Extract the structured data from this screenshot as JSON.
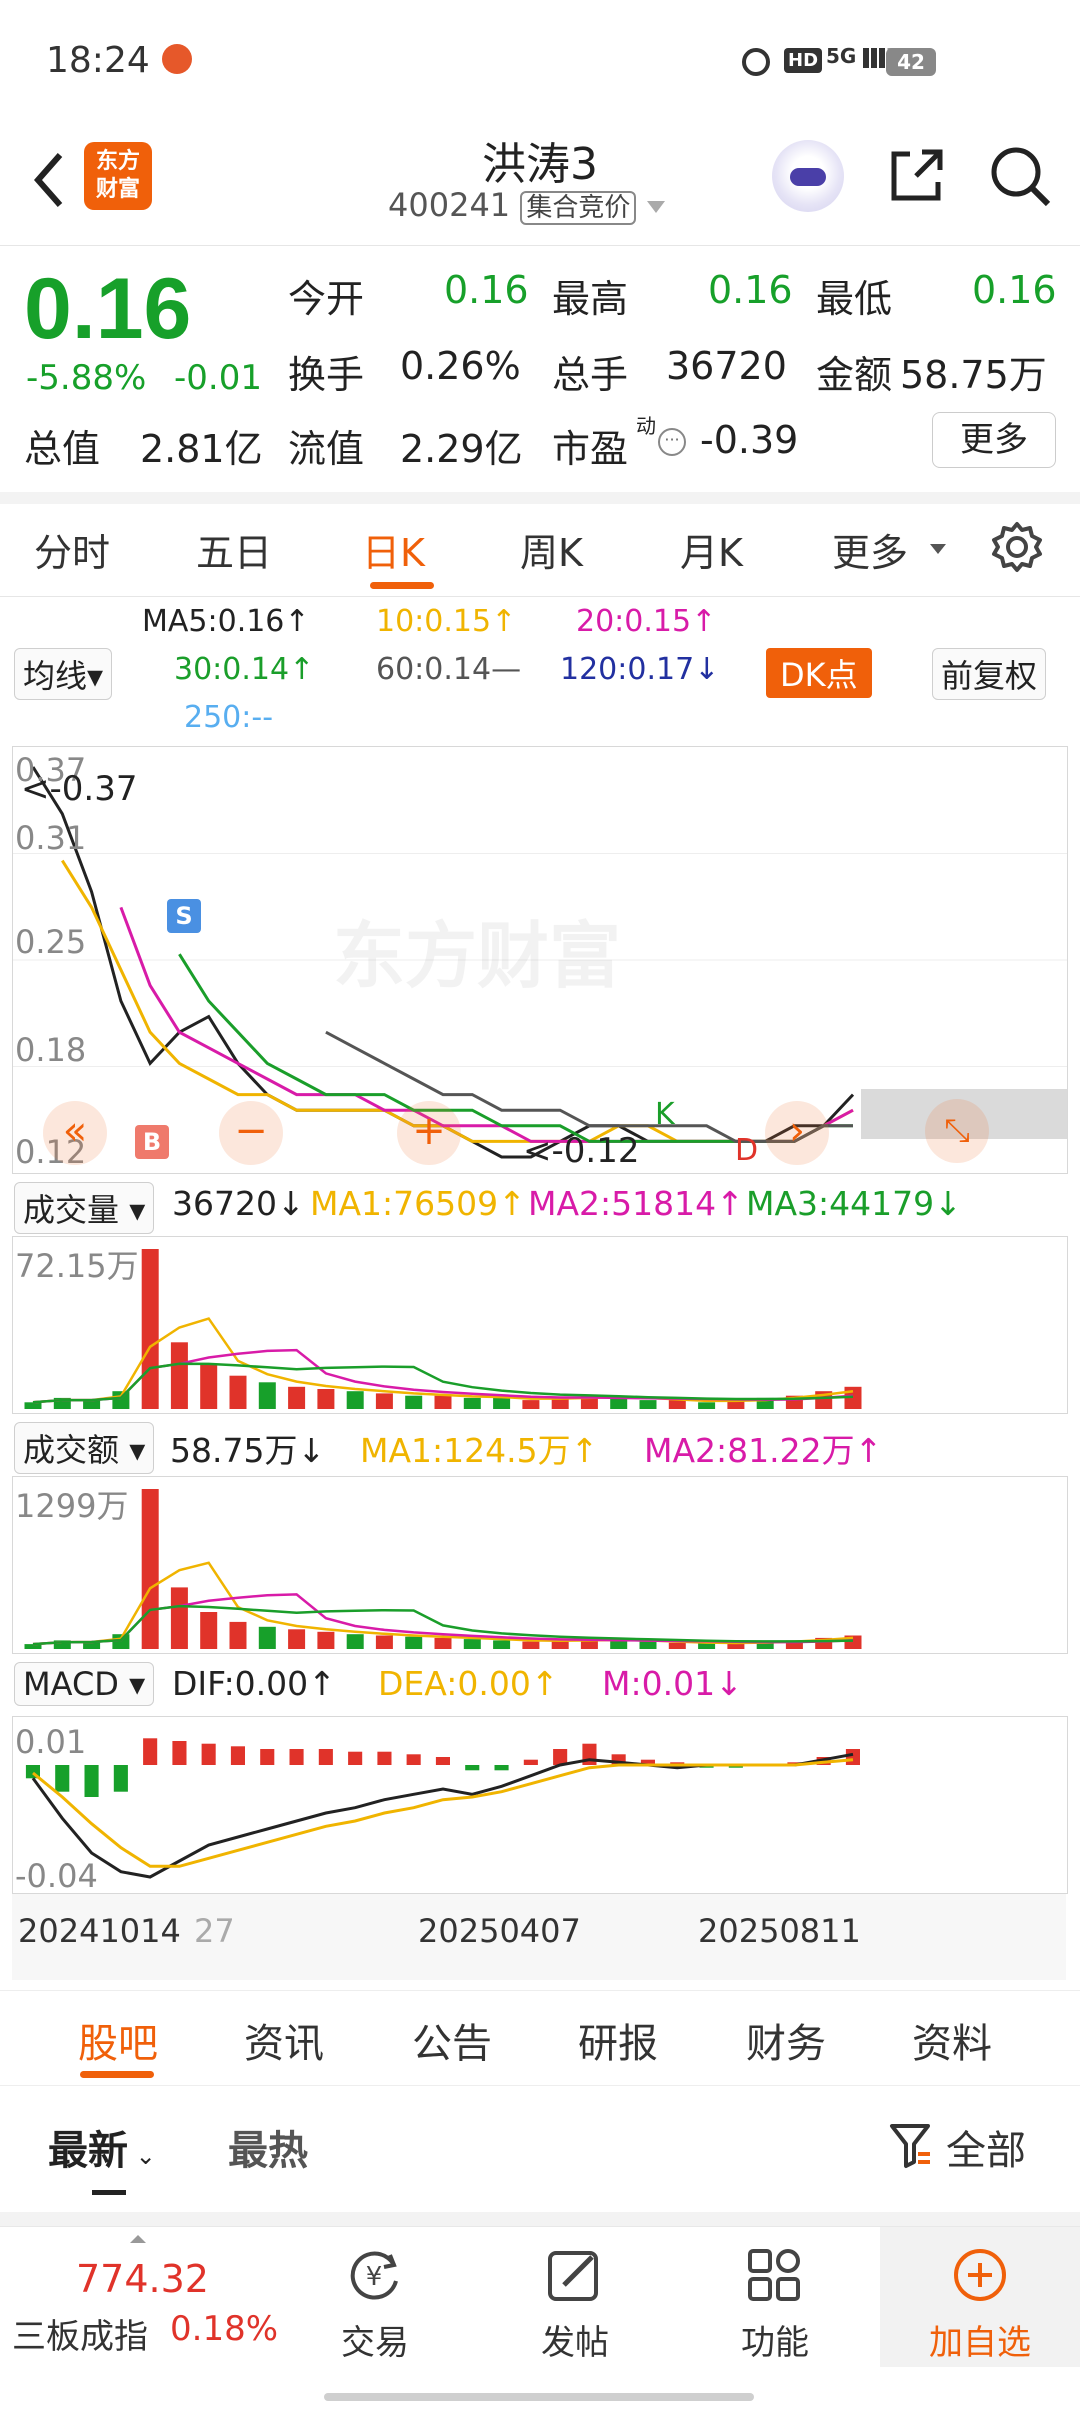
{
  "status_bar": {
    "time": "18:24",
    "network": "5G",
    "battery": "42"
  },
  "header": {
    "brand_logo_text": "东方财富",
    "stock_name": "洪涛3",
    "stock_code": "400241",
    "auction_tag": "集合竞价"
  },
  "quote": {
    "price": "0.16",
    "change_pct": "-5.88%",
    "change_amt": "-0.01",
    "rows": [
      [
        {
          "label": "今开",
          "value": "0.16"
        },
        {
          "label": "最高",
          "value": "0.16"
        },
        {
          "label": "最低",
          "value": "0.16"
        }
      ],
      [
        {
          "label": "换手",
          "value": "0.26%"
        },
        {
          "label": "总手",
          "value": "36720"
        },
        {
          "label": "金额",
          "value": "58.75万"
        }
      ]
    ],
    "total_value_label": "总值",
    "total_value": "2.81亿",
    "float_value_label": "流值",
    "float_value": "2.29亿",
    "pe_label": "市盈",
    "pe_sup": "动",
    "pe_value": "-0.39",
    "more_button": "更多"
  },
  "period_tabs": [
    "分时",
    "五日",
    "日K",
    "周K",
    "月K",
    "更多"
  ],
  "active_tab": "日K",
  "ma_legend": {
    "selector": "均线",
    "ma5": "MA5:0.16↑",
    "ma10": "10:0.15↑",
    "ma20": "20:0.15↑",
    "ma30": "30:0.14↑",
    "ma60": "60:0.14—",
    "ma120": "120:0.17↓",
    "ma250": "250:--",
    "dk_button": "DK点",
    "fq_button": "前复权"
  },
  "colors": {
    "accent": "#f0600a",
    "up": "#e0332a",
    "down": "#17a02a",
    "ma5": "#222222",
    "ma10": "#f0b400",
    "ma20": "#d81ba8",
    "ma30": "#1a9e2a",
    "ma60": "#555555",
    "ma120": "#2230a0",
    "ma250": "#58aef0"
  },
  "chart_data": [
    {
      "type": "line",
      "name": "日K",
      "y_ticks": [
        "0.37",
        "0.31",
        "0.25",
        "0.18",
        "0.12"
      ],
      "ylim": [
        0.12,
        0.37
      ],
      "annotations": [
        "<-0.37",
        "<-0.12",
        "S",
        "B",
        "K",
        "D"
      ],
      "series": [
        {
          "name": "MA5",
          "values": [
            0.37,
            0.34,
            0.29,
            0.22,
            0.18,
            0.2,
            0.21,
            0.18,
            0.16,
            0.15,
            0.15,
            0.15,
            0.15,
            0.14,
            0.14,
            0.13,
            0.12,
            0.12,
            0.13,
            0.14,
            0.14,
            0.13,
            0.13,
            0.13,
            0.13,
            0.13,
            0.14,
            0.14,
            0.16
          ]
        },
        {
          "name": "MA10",
          "values": [
            null,
            0.31,
            0.28,
            0.24,
            0.2,
            0.18,
            0.17,
            0.16,
            0.16,
            0.15,
            0.15,
            0.15,
            0.15,
            0.14,
            0.14,
            0.13,
            0.13,
            0.13,
            0.13,
            0.13,
            0.14,
            0.14,
            0.13,
            0.13,
            0.13,
            0.13,
            0.13,
            0.14,
            0.15
          ]
        },
        {
          "name": "MA20",
          "values": [
            null,
            null,
            null,
            0.28,
            0.23,
            0.2,
            0.19,
            0.18,
            0.17,
            0.16,
            0.16,
            0.16,
            0.15,
            0.15,
            0.14,
            0.14,
            0.14,
            0.13,
            0.13,
            0.13,
            0.13,
            0.13,
            0.13,
            0.13,
            0.13,
            0.13,
            0.13,
            0.14,
            0.15
          ]
        },
        {
          "name": "MA30",
          "values": [
            null,
            null,
            null,
            null,
            null,
            0.25,
            0.22,
            0.2,
            0.18,
            0.17,
            0.16,
            0.16,
            0.16,
            0.15,
            0.15,
            0.15,
            0.14,
            0.14,
            0.14,
            0.13,
            0.13,
            0.13,
            0.13,
            0.13,
            0.13,
            0.13,
            0.13,
            0.14,
            0.14
          ]
        },
        {
          "name": "MA60",
          "values": [
            null,
            null,
            null,
            null,
            null,
            null,
            null,
            null,
            null,
            null,
            0.2,
            0.19,
            0.18,
            0.17,
            0.16,
            0.16,
            0.15,
            0.15,
            0.15,
            0.14,
            0.14,
            0.14,
            0.14,
            0.14,
            0.13,
            0.13,
            0.13,
            0.14,
            0.14
          ]
        }
      ]
    },
    {
      "type": "bar",
      "name": "成交量",
      "max_label": "72.15万",
      "values": [
        3,
        5,
        4,
        8,
        72,
        30,
        20,
        15,
        12,
        10,
        9,
        8,
        7,
        6,
        6,
        5,
        5,
        4,
        5,
        6,
        5,
        4,
        4,
        3,
        4,
        5,
        6,
        8,
        10
      ],
      "colors": [
        "g",
        "g",
        "g",
        "g",
        "r",
        "r",
        "r",
        "r",
        "g",
        "r",
        "r",
        "g",
        "r",
        "g",
        "r",
        "g",
        "g",
        "r",
        "r",
        "r",
        "g",
        "g",
        "r",
        "g",
        "r",
        "g",
        "r",
        "r",
        "r"
      ]
    },
    {
      "type": "bar",
      "name": "成交额",
      "max_label": "1299万",
      "values": [
        40,
        70,
        60,
        120,
        1299,
        500,
        300,
        220,
        180,
        160,
        140,
        120,
        110,
        100,
        90,
        80,
        70,
        60,
        70,
        80,
        70,
        60,
        50,
        45,
        50,
        60,
        70,
        90,
        110
      ],
      "colors": [
        "g",
        "g",
        "g",
        "g",
        "r",
        "r",
        "r",
        "r",
        "g",
        "r",
        "r",
        "g",
        "r",
        "g",
        "r",
        "g",
        "g",
        "r",
        "r",
        "r",
        "g",
        "g",
        "r",
        "g",
        "r",
        "g",
        "r",
        "r",
        "r"
      ]
    },
    {
      "type": "bar",
      "name": "MACD",
      "y_ticks": [
        "0.01",
        "-0.04"
      ],
      "ylim": [
        -0.045,
        0.015
      ],
      "values": [
        -0.005,
        -0.01,
        -0.012,
        -0.01,
        0.01,
        0.009,
        0.008,
        0.007,
        0.006,
        0.006,
        0.006,
        0.005,
        0.005,
        0.004,
        0.003,
        -0.002,
        -0.002,
        0.002,
        0.006,
        0.008,
        0.004,
        0.002,
        0.001,
        -0.001,
        -0.001,
        0.0,
        0.001,
        0.003,
        0.006
      ],
      "dif": [
        -0.005,
        -0.02,
        -0.033,
        -0.04,
        -0.042,
        -0.036,
        -0.03,
        -0.027,
        -0.024,
        -0.021,
        -0.018,
        -0.016,
        -0.013,
        -0.011,
        -0.009,
        -0.011,
        -0.008,
        -0.004,
        0.0,
        0.002,
        0.001,
        0.0,
        -0.001,
        0.0,
        0.0,
        0.0,
        0.0,
        0.002,
        0.004
      ],
      "dea": [
        -0.003,
        -0.012,
        -0.022,
        -0.031,
        -0.038,
        -0.038,
        -0.035,
        -0.032,
        -0.029,
        -0.026,
        -0.023,
        -0.021,
        -0.018,
        -0.016,
        -0.013,
        -0.012,
        -0.01,
        -0.007,
        -0.004,
        -0.001,
        0.0,
        0.0,
        0.0,
        0.0,
        0.0,
        0.0,
        0.0,
        0.001,
        0.002
      ],
      "x_ticks": [
        "20241014",
        "27",
        "20250407",
        "20250811"
      ]
    }
  ],
  "vol_legend": {
    "selector": "成交量",
    "value": "36720↓",
    "ma1": "MA1:76509↑",
    "ma2": "MA2:51814↑",
    "ma3": "MA3:44179↓"
  },
  "amt_legend": {
    "selector": "成交额",
    "value": "58.75万↓",
    "ma1": "MA1:124.5万↑",
    "ma2": "MA2:81.22万↑"
  },
  "macd_legend": {
    "selector": "MACD",
    "dif": "DIF:0.00↑",
    "dea": "DEA:0.00↑",
    "m": "M:0.01↓"
  },
  "watermark": "东方财富",
  "info_tabs": [
    "股吧",
    "资讯",
    "公告",
    "研报",
    "财务",
    "资料"
  ],
  "active_info_tab": "股吧",
  "filter": {
    "latest": "最新",
    "hot": "最热",
    "all": "全部"
  },
  "bottom_bar": {
    "index_value": "774.32",
    "index_name": "三板成指",
    "index_change": "0.18%",
    "items": [
      {
        "icon": "trade-icon",
        "label": "交易"
      },
      {
        "icon": "post-icon",
        "label": "发帖"
      },
      {
        "icon": "functions-icon",
        "label": "功能"
      },
      {
        "icon": "add-watchlist-icon",
        "label": "加自选"
      }
    ]
  }
}
